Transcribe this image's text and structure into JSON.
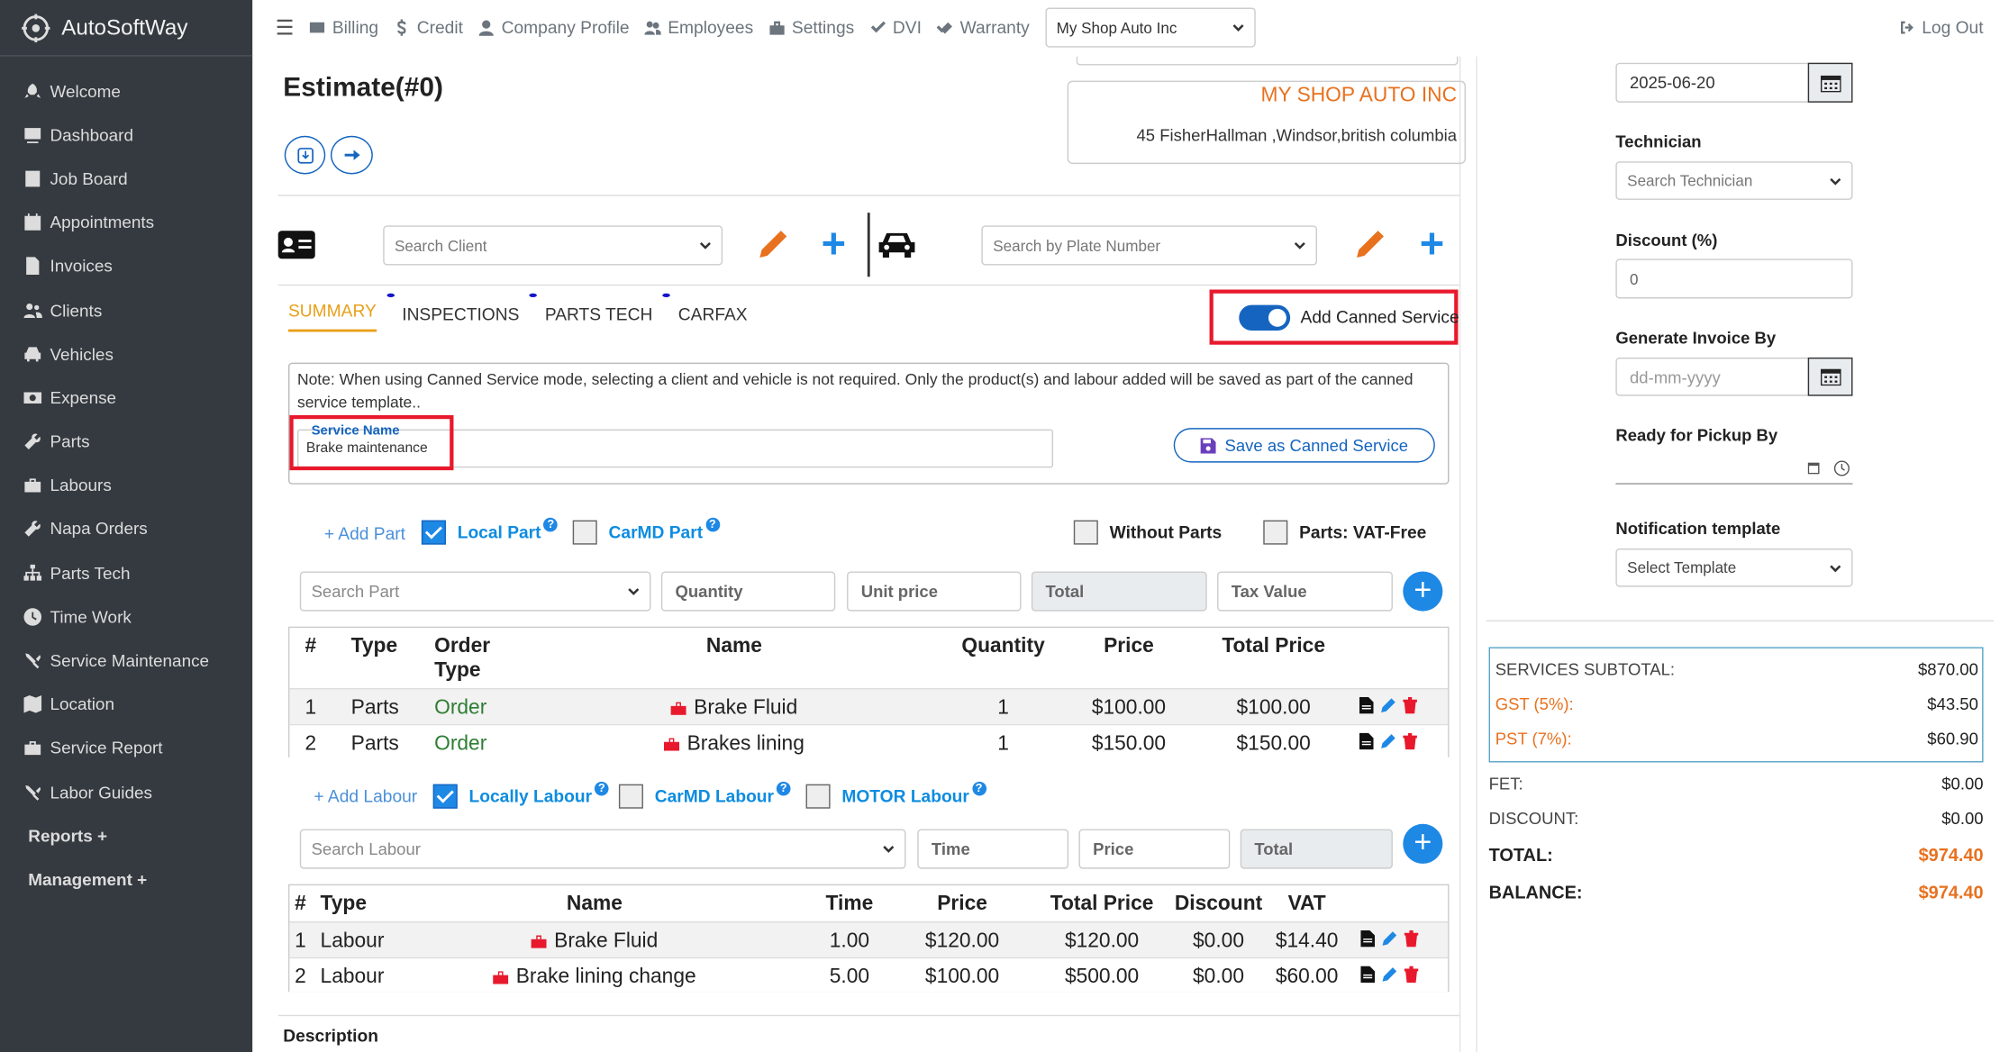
{
  "app": {
    "name": "AutoSoftWay"
  },
  "sidebar": {
    "items": [
      {
        "label": "Welcome",
        "icon": "rocket-icon"
      },
      {
        "label": "Dashboard",
        "icon": "dashboard-icon"
      },
      {
        "label": "Job Board",
        "icon": "building-icon"
      },
      {
        "label": "Appointments",
        "icon": "calendar-icon"
      },
      {
        "label": "Invoices",
        "icon": "file-icon"
      },
      {
        "label": "Clients",
        "icon": "users-icon"
      },
      {
        "label": "Vehicles",
        "icon": "car-icon"
      },
      {
        "label": "Expense",
        "icon": "money-icon"
      },
      {
        "label": "Parts",
        "icon": "wrench-icon"
      },
      {
        "label": "Labours",
        "icon": "toolbox-icon"
      },
      {
        "label": "Napa Orders",
        "icon": "wrench-icon"
      },
      {
        "label": "Parts Tech",
        "icon": "sitemap-icon"
      },
      {
        "label": "Time Work",
        "icon": "clock-icon"
      },
      {
        "label": "Service Maintenance",
        "icon": "tools-icon"
      },
      {
        "label": "Location",
        "icon": "map-icon"
      },
      {
        "label": "Service Report",
        "icon": "toolbox-icon"
      },
      {
        "label": "Labor Guides",
        "icon": "tools-icon"
      },
      {
        "label": "Reports +",
        "icon": ""
      },
      {
        "label": "Management +",
        "icon": ""
      }
    ]
  },
  "topbar": {
    "items": [
      {
        "label": "Billing",
        "icon": "billing-icon"
      },
      {
        "label": "Credit",
        "icon": "dollar-icon"
      },
      {
        "label": "Company Profile",
        "icon": "user-icon"
      },
      {
        "label": "Employees",
        "icon": "users-icon"
      },
      {
        "label": "Settings",
        "icon": "toolbox-icon"
      },
      {
        "label": "DVI",
        "icon": "check-icon"
      },
      {
        "label": "Warranty",
        "icon": "check-double-icon"
      }
    ],
    "shop_select": "My Shop Auto Inc",
    "logout": "Log Out"
  },
  "estimate": {
    "title": "Estimate(#0)",
    "shop_name": "MY SHOP AUTO INC",
    "shop_address": "45 FisherHallman ,Windsor,british columbia"
  },
  "search": {
    "client_placeholder": "Search Client",
    "plate_placeholder": "Search by Plate Number"
  },
  "tabs": [
    {
      "label": "SUMMARY",
      "active": true
    },
    {
      "label": "INSPECTIONS"
    },
    {
      "label": "PARTS TECH"
    },
    {
      "label": "CARFAX"
    }
  ],
  "canned": {
    "toggle_label": "Add Canned Service",
    "toggle_on": true,
    "note": "Note: When using Canned Service mode, selecting a client and vehicle is not required. Only the product(s) and labour added will be saved as part of the canned service template..",
    "service_name_label": "Service Name",
    "service_name_value": "Brake maintenance",
    "save_label": "Save as Canned Service"
  },
  "parts_opts": {
    "add": "+ Add Part",
    "local": "Local Part",
    "local_checked": true,
    "carmd": "CarMD Part",
    "without": "Without Parts",
    "vat_free": "Parts: VAT-Free"
  },
  "parts_inputs": {
    "search": "Search Part",
    "quantity": "Quantity",
    "unit_price": "Unit price",
    "total": "Total",
    "tax": "Tax Value"
  },
  "parts_table": {
    "headers": [
      "#",
      "Type",
      "Order Type",
      "Name",
      "Quantity",
      "Price",
      "Total Price"
    ],
    "rows": [
      [
        "1",
        "Parts",
        "Order",
        "Brake Fluid",
        "1",
        "$100.00",
        "$100.00"
      ],
      [
        "2",
        "Parts",
        "Order",
        "Brakes lining",
        "1",
        "$150.00",
        "$150.00"
      ]
    ]
  },
  "labour_opts": {
    "add": "+ Add Labour",
    "local": "Locally Labour",
    "local_checked": true,
    "carmd": "CarMD Labour",
    "motor": "MOTOR Labour"
  },
  "labour_inputs": {
    "search": "Search Labour",
    "time": "Time",
    "price": "Price",
    "total": "Total"
  },
  "labour_table": {
    "headers": [
      "#",
      "Type",
      "Name",
      "Time",
      "Price",
      "Total Price",
      "Discount",
      "VAT"
    ],
    "rows": [
      [
        "1",
        "Labour",
        "Brake Fluid",
        "1.00",
        "$120.00",
        "$120.00",
        "$0.00",
        "$14.40"
      ],
      [
        "2",
        "Labour",
        "Brake lining change",
        "5.00",
        "$100.00",
        "$500.00",
        "$0.00",
        "$60.00"
      ]
    ]
  },
  "description_label": "Description",
  "right": {
    "date": "2025-06-20",
    "technician_label": "Technician",
    "technician_placeholder": "Search Technician",
    "discount_label": "Discount (%)",
    "discount_value": "0",
    "generate_label": "Generate Invoice By",
    "generate_placeholder": "dd-mm-yyyy",
    "pickup_label": "Ready for Pickup By",
    "notification_label": "Notification template",
    "notification_placeholder": "Select Template"
  },
  "totals": {
    "subtotal_label": "SERVICES SUBTOTAL:",
    "subtotal": "$870.00",
    "gst_label": "GST (5%):",
    "gst": "$43.50",
    "pst_label": "PST (7%):",
    "pst": "$60.90",
    "fet_label": "FET:",
    "fet": "$0.00",
    "discount_label": "DISCOUNT:",
    "discount": "$0.00",
    "total_label": "TOTAL:",
    "total": "$974.40",
    "balance_label": "BALANCE:",
    "balance": "$974.40"
  },
  "colors": {
    "sidebar": "#343a40",
    "accent": "#1e88e5",
    "orange": "#e8711e",
    "highlight": "#e8192c"
  }
}
